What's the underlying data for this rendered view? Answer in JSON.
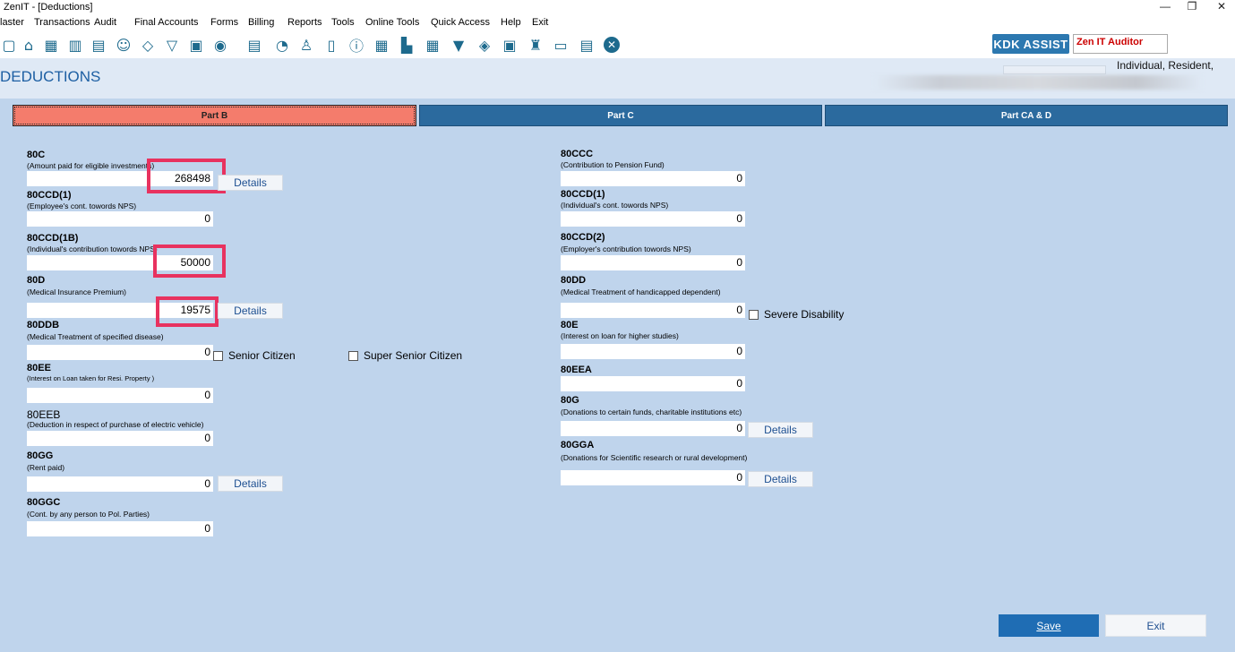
{
  "window": {
    "title": "ZenIT - [Deductions]",
    "minimize": "—",
    "restore": "❐",
    "close": "✕"
  },
  "menu": [
    "laster",
    "Transactions",
    "Audit",
    "Final Accounts",
    "Forms",
    "Billing",
    "Reports",
    "Tools",
    "Online Tools",
    "Quick Access",
    "Help",
    "Exit"
  ],
  "toolbar": {
    "kdk_label": "KDK ASSIST",
    "auditor_label": "Zen IT Auditor"
  },
  "header": {
    "page_title": "DEDUCTIONS",
    "status": "Individual, Resident,"
  },
  "tabs": [
    "Part B",
    "Part C",
    "Part CA & D"
  ],
  "left": {
    "f80c": {
      "label": "80C",
      "sub": "(Amount paid for eligible investments)",
      "value": "268498"
    },
    "f80ccd1": {
      "label": "80CCD(1)",
      "sub": "(Employee's cont. towords NPS)",
      "value": "0"
    },
    "f80ccd1b": {
      "label": "80CCD(1B)",
      "sub": "(Individual's contribution towords NPS)",
      "value": "50000"
    },
    "f80d": {
      "label": "80D",
      "sub": "(Medical Insurance Premium)",
      "value": "19575"
    },
    "f80ddb": {
      "label": "80DDB",
      "sub": "(Medical Treatment of specified disease)",
      "value": "0"
    },
    "f80ee": {
      "label": "80EE",
      "sub": "(Interest on Loan taken for Resi. Property )",
      "value": "0"
    },
    "f80eeb": {
      "label": "80EEB",
      "sub": "(Deduction in respect of purchase of electric vehicle)",
      "value": "0"
    },
    "f80gg": {
      "label": "80GG",
      "sub": "(Rent paid)",
      "value": "0"
    },
    "f80ggc": {
      "label": "80GGC",
      "sub": "(Cont. by any person to Pol. Parties)",
      "value": "0"
    }
  },
  "right": {
    "f80ccc": {
      "label": "80CCC",
      "sub": "(Contribution to Pension Fund)",
      "value": "0"
    },
    "f80ccd1": {
      "label": "80CCD(1)",
      "sub": "(Individual's cont. towords NPS)",
      "value": "0"
    },
    "f80ccd2": {
      "label": "80CCD(2)",
      "sub": "(Employer's contribution towords NPS)",
      "value": "0"
    },
    "f80dd": {
      "label": "80DD",
      "sub": "(Medical Treatment of handicapped dependent)",
      "value": "0"
    },
    "f80e": {
      "label": "80E",
      "sub": "(Interest on loan for higher studies)",
      "value": "0"
    },
    "f80eea": {
      "label": "80EEA",
      "value": "0"
    },
    "f80g": {
      "label": "80G",
      "sub": "(Donations to certain funds, charitable institutions etc)",
      "value": "0"
    },
    "f80gga": {
      "label": "80GGA",
      "sub": "(Donations for Scientific research or rural development)",
      "value": "0"
    }
  },
  "checkboxes": {
    "senior": "Senior Citizen",
    "super_senior": "Super Senior Citizen",
    "severe": "Severe Disability"
  },
  "buttons": {
    "details": "Details",
    "save": "Save",
    "exit": "Exit"
  },
  "colors": {
    "active_tab": "#f47c6c",
    "tab": "#2b6a9e",
    "highlight": "#e8325f",
    "panel": "#bfd4ec"
  }
}
